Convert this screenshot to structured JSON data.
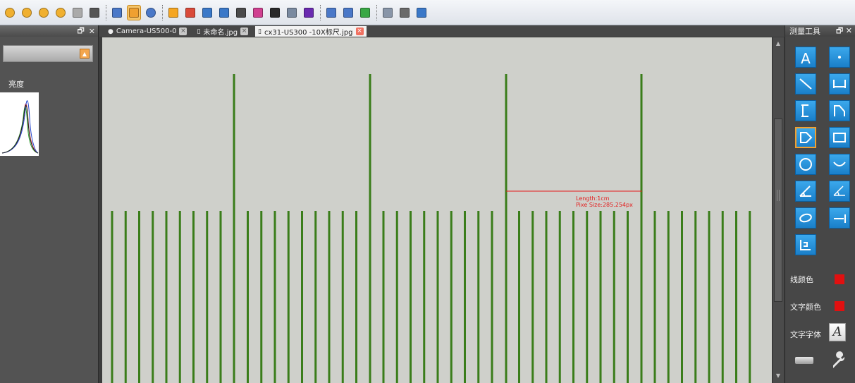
{
  "toolbar": {
    "buttons": [
      {
        "name": "zoom-in-icon",
        "active": false
      },
      {
        "name": "zoom-out-icon",
        "active": false
      },
      {
        "name": "zoom-fit-icon",
        "active": false
      },
      {
        "name": "zoom-actual-icon",
        "active": false
      },
      {
        "name": "zoom-reset-icon",
        "active": false
      },
      {
        "name": "select-arrow-icon",
        "active": false
      },
      {
        "name": "rect-select-icon",
        "active": false
      },
      {
        "name": "pan-hand-icon",
        "active": true
      },
      {
        "name": "magnifier-icon",
        "active": false
      },
      {
        "name": "brightness-icon",
        "active": false
      },
      {
        "name": "color-adjust-icon",
        "active": false
      },
      {
        "name": "histogram-icon",
        "active": false
      },
      {
        "name": "levels-icon",
        "active": false
      },
      {
        "name": "image-icon",
        "active": false
      },
      {
        "name": "palette-icon",
        "active": false
      },
      {
        "name": "effects-icon",
        "active": false
      },
      {
        "name": "history-icon",
        "active": false
      },
      {
        "name": "check-icon",
        "active": false
      },
      {
        "name": "flip-icon",
        "active": false
      },
      {
        "name": "triangle-icon",
        "active": false
      },
      {
        "name": "photo-icon",
        "active": false
      },
      {
        "name": "database-icon",
        "active": false
      },
      {
        "name": "document-icon",
        "active": false
      },
      {
        "name": "paint-icon",
        "active": false
      }
    ]
  },
  "left_panel": {
    "brightness_label": "亮度"
  },
  "tabs": [
    {
      "label": "Camera-US500-0",
      "active": false,
      "icon": "camera-icon"
    },
    {
      "label": "未命名.jpg",
      "active": false,
      "icon": "file-icon"
    },
    {
      "label": "cx31-US300 -10X标尺.jpg",
      "active": true,
      "icon": "file-icon"
    }
  ],
  "measurement": {
    "length_label": "Length:1cm",
    "pixel_size_label": "Pixe Size:285.254px"
  },
  "right_panel": {
    "title": "测量工具",
    "tools": [
      "text-tool-icon",
      "point-tool-icon",
      "line-tool-icon",
      "horizontal-line-tool-icon",
      "vertical-line-tool-icon",
      "polyline-tool-icon",
      "polygon-tool-icon",
      "rectangle-tool-icon",
      "circle-tool-icon",
      "arc-tool-icon",
      "angle-tool-icon",
      "angle-alt-tool-icon",
      "ellipse-tool-icon",
      "parallel-line-tool-icon",
      "calibration-tool-icon"
    ],
    "selected_tool": "polygon-tool-icon",
    "line_color_label": "线颜色",
    "text_color_label": "文字颜色",
    "text_font_label": "文字字体",
    "line_color": "#e11010",
    "text_color": "#e11010"
  },
  "colors": {
    "ruler_green": "#3a7d1a",
    "measure_red": "#e41c1c",
    "tool_blue": "#2a90dc"
  }
}
